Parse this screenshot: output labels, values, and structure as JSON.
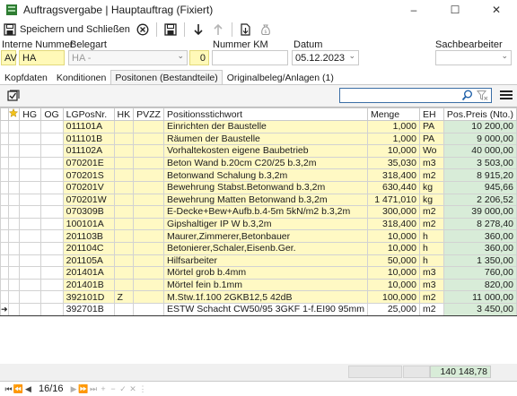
{
  "window": {
    "title": "Auftragsvergabe | Hauptauftrag (Fixiert)",
    "btn_minimize": "–",
    "btn_maximize": "☐",
    "btn_close": "✕"
  },
  "toolbar": {
    "save_close_label": "Speichern und Schließen"
  },
  "header": {
    "internal_number_label": "Interne Nummer",
    "internal_prefix": "AV",
    "internal_value": "HA",
    "bookingtype_label": "Belegart",
    "bookingtype_value": "HA -",
    "bookingtype_number": "0",
    "km_label": "Nummer KM",
    "date_label": "Datum",
    "date_value": "05.12.2023",
    "clerk_label": "Sachbearbeiter",
    "clerk_value": ""
  },
  "tabs": [
    {
      "label": "Kopfdaten"
    },
    {
      "label": "Konditionen"
    },
    {
      "label": "Positonen (Bestandteile)"
    },
    {
      "label": "Originalbeleg/Anlagen (1)"
    }
  ],
  "search": {
    "value": ""
  },
  "columns": {
    "hg": "HG",
    "og": "OG",
    "lgposnr": "LGPosNr.",
    "hk": "HK",
    "pvzz": "PVZZ",
    "stichwort": "Positionsstichwort",
    "menge": "Menge",
    "eh": "EH",
    "preis": "Pos.Preis (Nto.)"
  },
  "rows": [
    {
      "nr": "011101A",
      "hk": "",
      "pvzz": "",
      "text": "Einrichten der Baustelle",
      "menge": "1,000",
      "eh": "PA",
      "preis": "10 200,00"
    },
    {
      "nr": "011101B",
      "hk": "",
      "pvzz": "",
      "text": "Räumen der Baustelle",
      "menge": "1,000",
      "eh": "PA",
      "preis": "9 000,00"
    },
    {
      "nr": "011102A",
      "hk": "",
      "pvzz": "",
      "text": "Vorhaltekosten eigene Baubetrieb",
      "menge": "10,000",
      "eh": "Wo",
      "preis": "40 000,00"
    },
    {
      "nr": "070201E",
      "hk": "",
      "pvzz": "",
      "text": "Beton Wand b.20cm C20/25 b.3,2m",
      "menge": "35,030",
      "eh": "m3",
      "preis": "3 503,00"
    },
    {
      "nr": "070201S",
      "hk": "",
      "pvzz": "",
      "text": "Betonwand Schalung b.3,2m",
      "menge": "318,400",
      "eh": "m2",
      "preis": "8 915,20"
    },
    {
      "nr": "070201V",
      "hk": "",
      "pvzz": "",
      "text": "Bewehrung Stabst.Betonwand b.3,2m",
      "menge": "630,440",
      "eh": "kg",
      "preis": "945,66"
    },
    {
      "nr": "070201W",
      "hk": "",
      "pvzz": "",
      "text": "Bewehrung Matten Betonwand b.3,2m",
      "menge": "1 471,010",
      "eh": "kg",
      "preis": "2 206,52"
    },
    {
      "nr": "070309B",
      "hk": "",
      "pvzz": "",
      "text": "E-Decke+Bew+Aufb.b.4-5m 5kN/m2 b.3,2m",
      "menge": "300,000",
      "eh": "m2",
      "preis": "39 000,00"
    },
    {
      "nr": "100101A",
      "hk": "",
      "pvzz": "",
      "text": "Gipshaltiger IP W b.3,2m",
      "menge": "318,400",
      "eh": "m2",
      "preis": "8 278,40"
    },
    {
      "nr": "201103B",
      "hk": "",
      "pvzz": "",
      "text": "Maurer,Zimmerer,Betonbauer",
      "menge": "10,000",
      "eh": "h",
      "preis": "360,00"
    },
    {
      "nr": "201104C",
      "hk": "",
      "pvzz": "",
      "text": "Betonierer,Schaler,Eisenb.Ger.",
      "menge": "10,000",
      "eh": "h",
      "preis": "360,00"
    },
    {
      "nr": "201105A",
      "hk": "",
      "pvzz": "",
      "text": "Hilfsarbeiter",
      "menge": "50,000",
      "eh": "h",
      "preis": "1 350,00"
    },
    {
      "nr": "201401A",
      "hk": "",
      "pvzz": "",
      "text": "Mörtel grob b.4mm",
      "menge": "10,000",
      "eh": "m3",
      "preis": "760,00"
    },
    {
      "nr": "201401B",
      "hk": "",
      "pvzz": "",
      "text": "Mörtel fein b.1mm",
      "menge": "10,000",
      "eh": "m3",
      "preis": "820,00"
    },
    {
      "nr": "392101D",
      "hk": "Z",
      "pvzz": "",
      "text": "M.Stw.1f.100 2GKB12,5 42dB",
      "menge": "100,000",
      "eh": "m2",
      "preis": "11 000,00"
    },
    {
      "nr": "392701B",
      "hk": "",
      "pvzz": "",
      "text": "ESTW Schacht CW50/95 3GKF 1-f.EI90 95mm",
      "menge": "25,000",
      "eh": "m2",
      "preis": "3 450,00"
    }
  ],
  "totals": {
    "sum": "140 148,78"
  },
  "nav": {
    "counter": "16/16"
  }
}
